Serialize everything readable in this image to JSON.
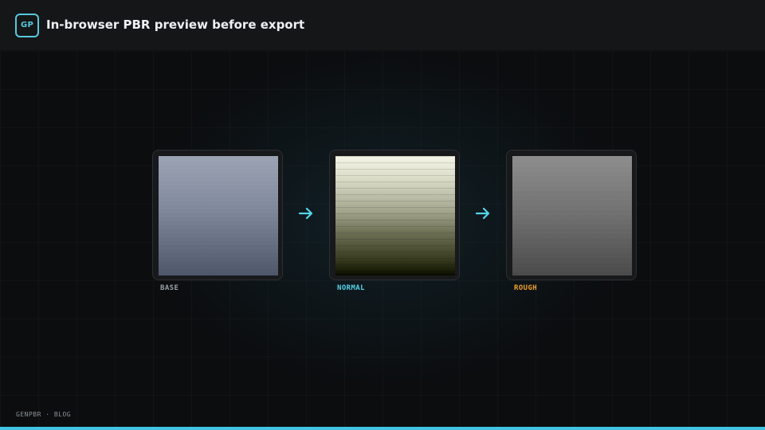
{
  "header": {
    "logo_text": "GP",
    "title": "In-browser PBR preview before export"
  },
  "maps": [
    {
      "label": "BASE",
      "label_color": "#9aa0a6"
    },
    {
      "label": "NORMAL",
      "label_color": "#56d4e8"
    },
    {
      "label": "ROUGH",
      "label_color": "#f0a02a"
    }
  ],
  "arrows": [
    {
      "icon": "arrow-right-icon",
      "color": "#56d4e8"
    },
    {
      "icon": "arrow-right-icon",
      "color": "#56d4e8"
    }
  ],
  "footer": {
    "brand": "GENPBR · BLOG"
  },
  "colors": {
    "accent": "#3fc5e2",
    "background": "#0b0d0f",
    "header_bg": "#151618"
  }
}
